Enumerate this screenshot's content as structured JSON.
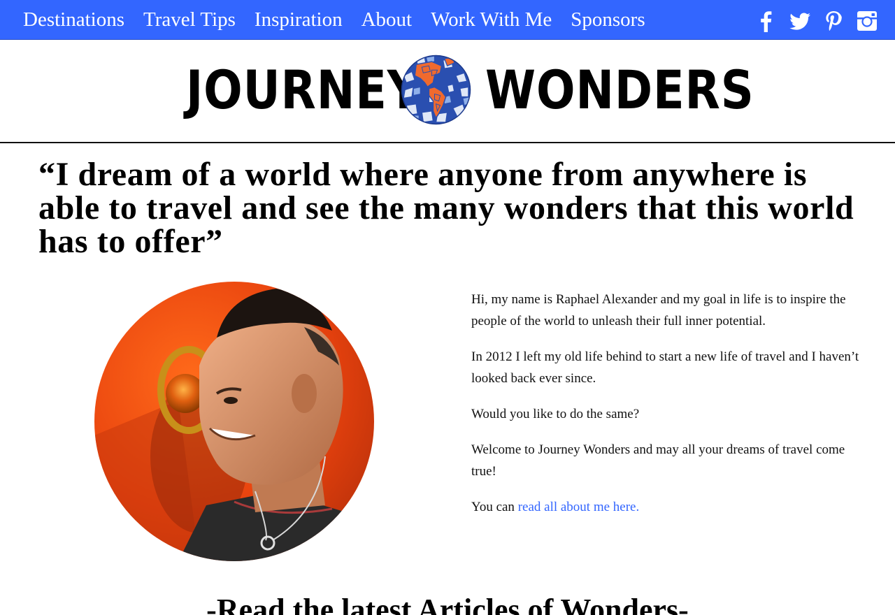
{
  "nav": {
    "items": [
      {
        "label": "Destinations"
      },
      {
        "label": "Travel Tips"
      },
      {
        "label": "Inspiration"
      },
      {
        "label": "About"
      },
      {
        "label": "Work With Me"
      },
      {
        "label": "Sponsors"
      }
    ],
    "social": [
      "facebook-icon",
      "twitter-icon",
      "pinterest-icon",
      "instagram-icon"
    ],
    "colors": {
      "bar": "#3366ff",
      "text": "#ffffff"
    }
  },
  "logo": {
    "left_word": "JOURNEY",
    "right_word": "WONDERS"
  },
  "quote": "“I dream of a world where anyone from anywhere is able to travel and see the many wonders that this world has to offer”",
  "intro": {
    "p1": "Hi, my name is Raphael Alexander and my goal in life is to inspire the people of the world to unleash their full inner potential.",
    "p2": "In 2012 I left my old life behind to start a new life of travel and I haven’t looked back ever since.",
    "p3": "Would you like to do the same?",
    "p4": "Welcome to Journey Wonders and may all your dreams of travel come true!",
    "p5_prefix": "You can ",
    "p5_link": "read all about me here.",
    "link_color": "#3366ff"
  },
  "section_heading": "-Read the latest Articles of Wonders-"
}
